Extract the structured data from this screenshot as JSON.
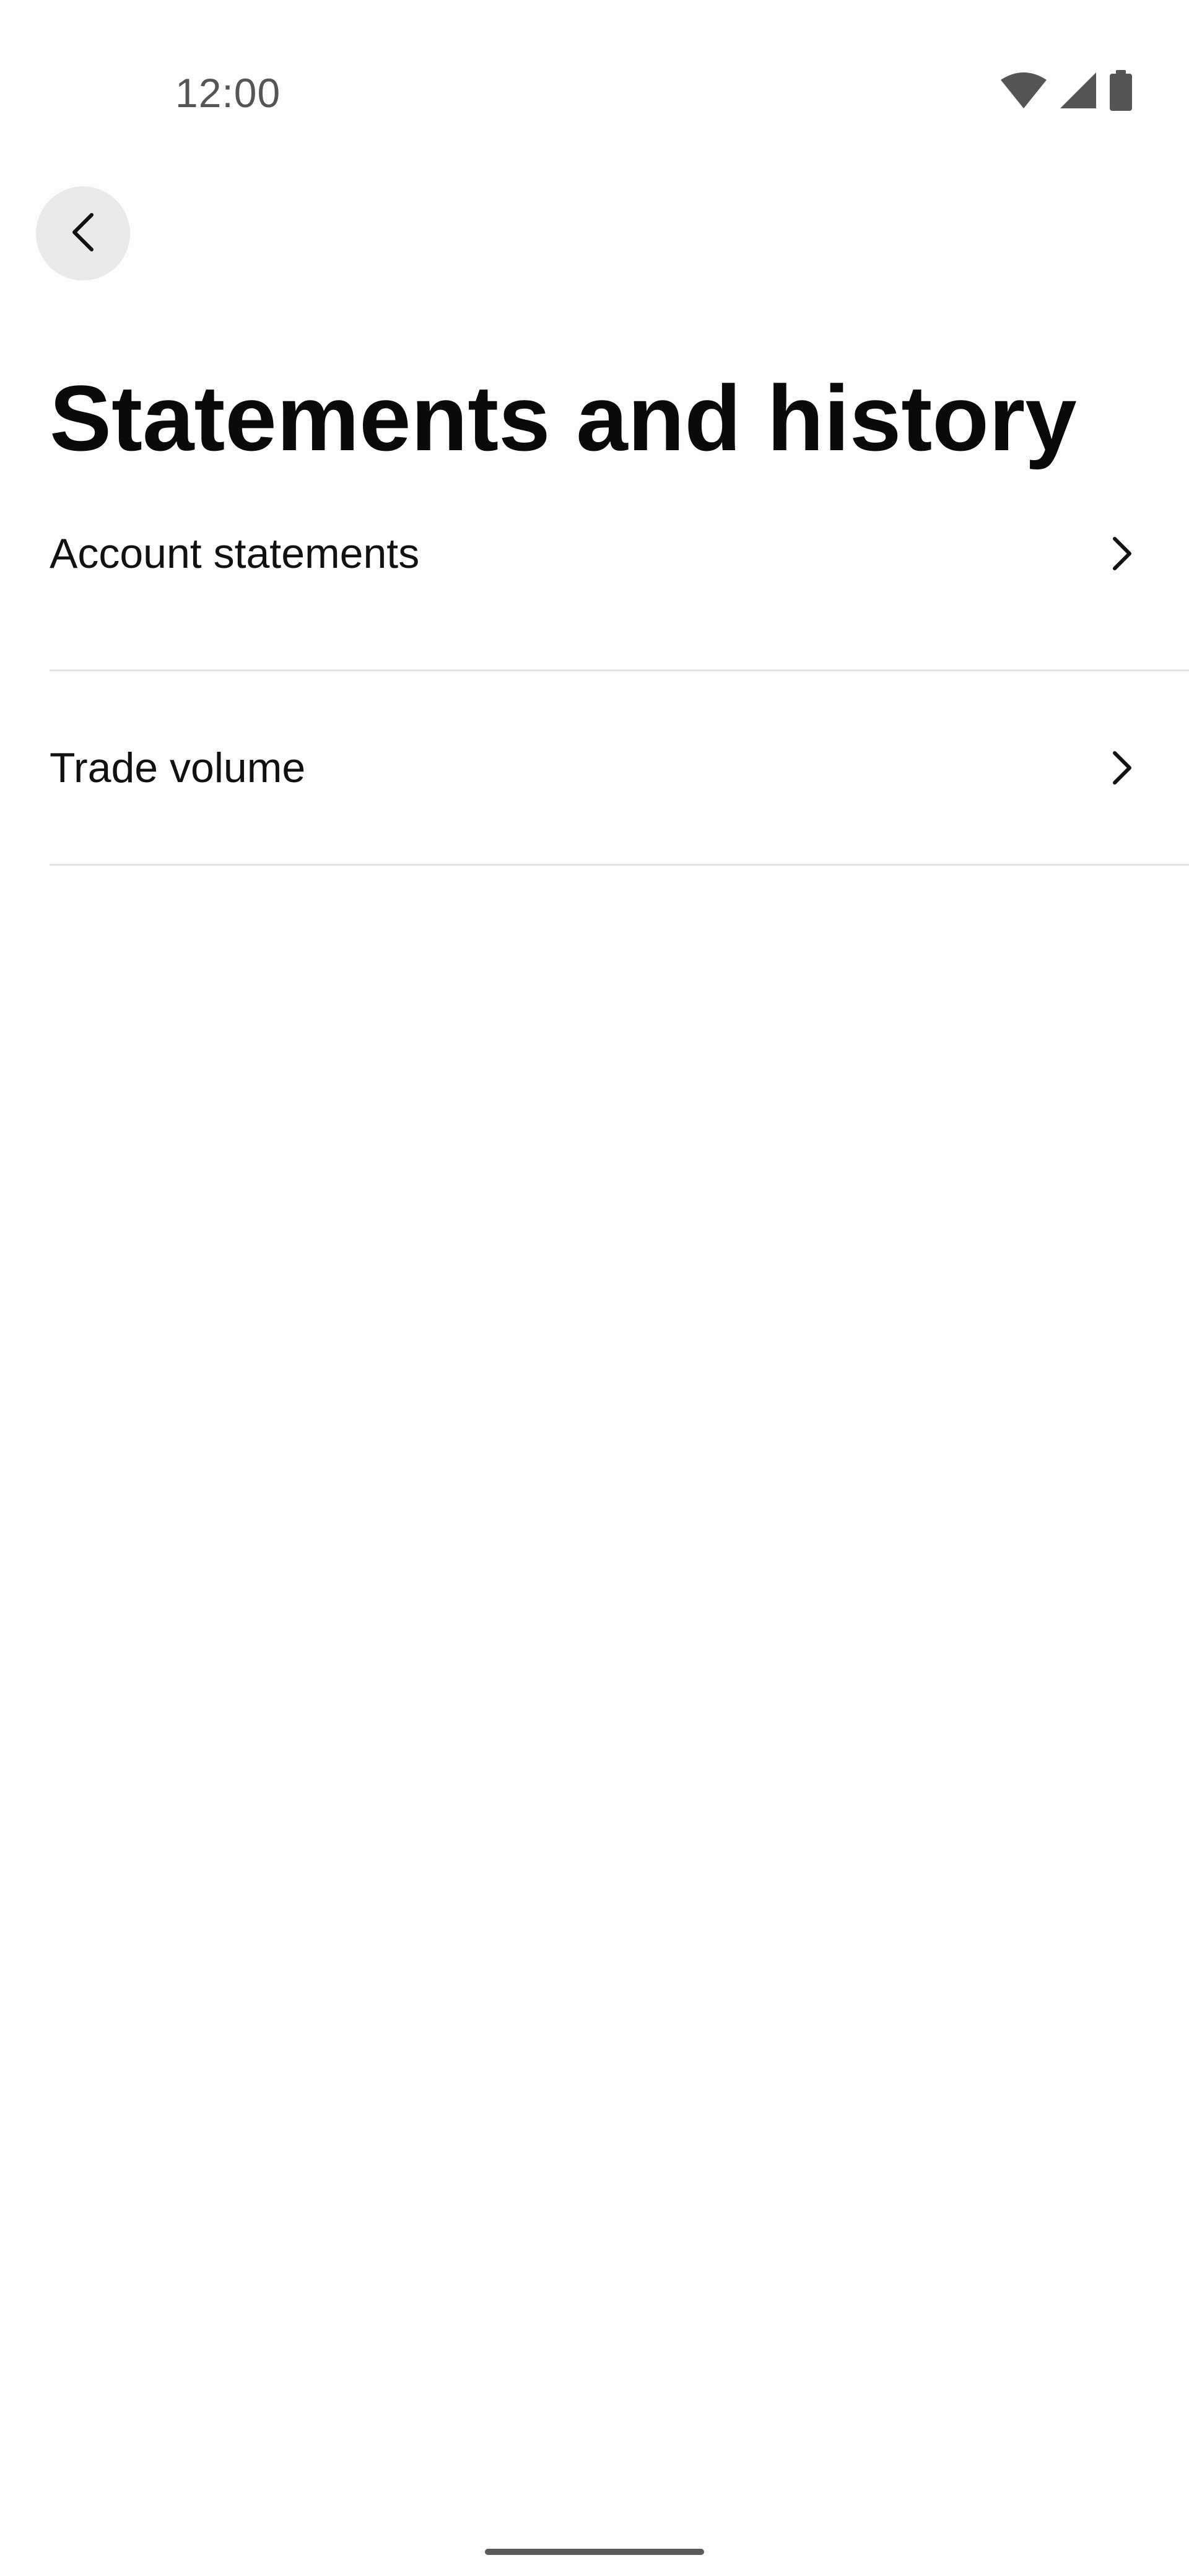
{
  "status_bar": {
    "time": "12:00",
    "icons": [
      "wifi-icon",
      "cellular-signal-icon",
      "battery-icon"
    ]
  },
  "header": {
    "back_icon": "chevron-left-icon",
    "title": "Statements and history"
  },
  "menu": {
    "items": [
      {
        "label": "Account statements",
        "icon": "chevron-right-icon"
      },
      {
        "label": "Trade volume",
        "icon": "chevron-right-icon"
      }
    ]
  },
  "colors": {
    "background": "#fdfdfd",
    "back_button_bg": "#e9e9e9",
    "divider": "#e3e3e3",
    "status_icons": "#555555"
  }
}
